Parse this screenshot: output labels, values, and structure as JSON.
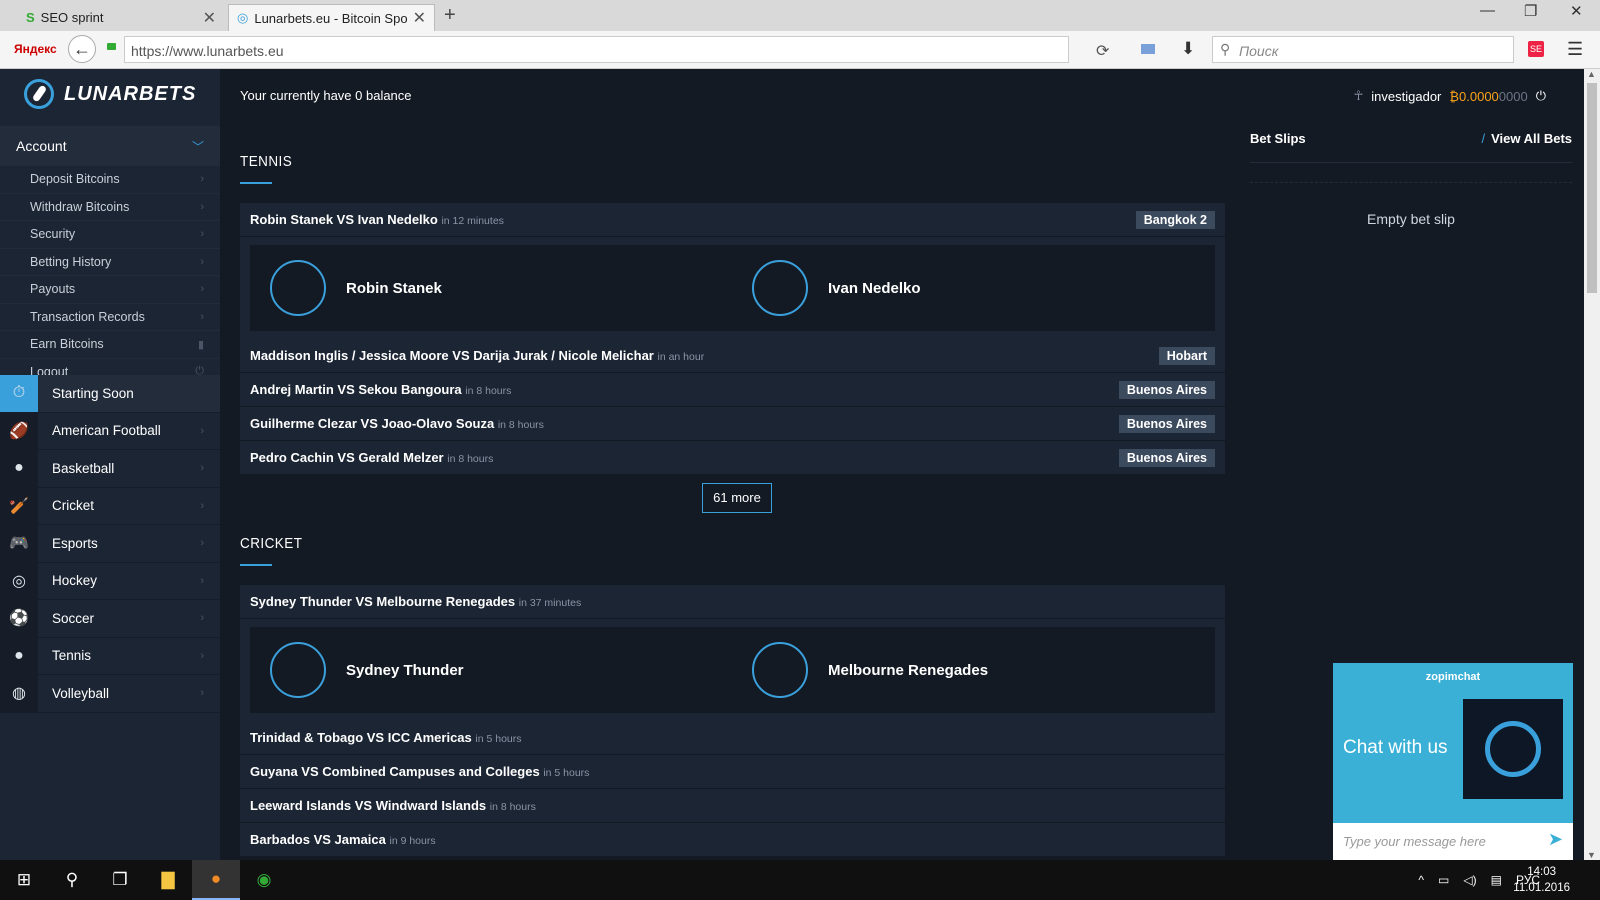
{
  "browser": {
    "tabs": [
      {
        "title": "SEO sprint",
        "icon": "S"
      },
      {
        "title": "Lunarbets.eu - Bitcoin Spo..."
      }
    ],
    "yandex": "Яндекс",
    "url": "https://www.lunarbets.eu",
    "search_placeholder": "Поиск",
    "se_badge": "SE"
  },
  "site": {
    "logo": "LUNARBETS",
    "balance_text": "Your currently have 0 balance",
    "user": {
      "name": "investigador",
      "btc_symbol": "₿",
      "amount": "0.0000",
      "amount_tail": "0000"
    },
    "account_label": "Account",
    "account_items": [
      "Deposit Bitcoins",
      "Withdraw Bitcoins",
      "Security",
      "Betting History",
      "Payouts",
      "Transaction Records",
      "Earn Bitcoins",
      "Logout"
    ],
    "sports": [
      {
        "label": "Starting Soon",
        "icon": "stopwatch-icon",
        "glyph": "⏱"
      },
      {
        "label": "American Football",
        "icon": "american-football-icon",
        "glyph": "🏈"
      },
      {
        "label": "Basketball",
        "icon": "basketball-icon",
        "glyph": "●"
      },
      {
        "label": "Cricket",
        "icon": "cricket-bat-icon",
        "glyph": "🏏"
      },
      {
        "label": "Esports",
        "icon": "gamepad-icon",
        "glyph": "🎮"
      },
      {
        "label": "Hockey",
        "icon": "hockey-icon",
        "glyph": "◎"
      },
      {
        "label": "Soccer",
        "icon": "soccer-ball-icon",
        "glyph": "⚽"
      },
      {
        "label": "Tennis",
        "icon": "tennis-ball-icon",
        "glyph": "●"
      },
      {
        "label": "Volleyball",
        "icon": "volleyball-icon",
        "glyph": "◍"
      }
    ],
    "tennis": {
      "title": "TENNIS",
      "featured": {
        "name": "Robin Stanek VS Ivan Nedelko",
        "when": "in 12 minutes",
        "badge": "Bangkok 2",
        "team1": "Robin Stanek",
        "team2": "Ivan Nedelko"
      },
      "events": [
        {
          "name": "Maddison Inglis / Jessica Moore VS Darija Jurak / Nicole Melichar",
          "when": "in an hour",
          "badge": "Hobart"
        },
        {
          "name": "Andrej Martin VS Sekou Bangoura",
          "when": "in 8 hours",
          "badge": "Buenos Aires"
        },
        {
          "name": "Guilherme Clezar VS Joao-Olavo Souza",
          "when": "in 8 hours",
          "badge": "Buenos Aires"
        },
        {
          "name": "Pedro Cachin VS Gerald Melzer",
          "when": "in 8 hours",
          "badge": "Buenos Aires"
        }
      ],
      "more": "61 more"
    },
    "cricket": {
      "title": "CRICKET",
      "featured": {
        "name": "Sydney Thunder VS Melbourne Renegades",
        "when": "in 37 minutes",
        "team1": "Sydney Thunder",
        "team2": "Melbourne Renegades"
      },
      "events": [
        {
          "name": "Trinidad & Tobago VS ICC Americas",
          "when": "in 5 hours"
        },
        {
          "name": "Guyana VS Combined Campuses and Colleges",
          "when": "in 5 hours"
        },
        {
          "name": "Leeward Islands VS Windward Islands",
          "when": "in 8 hours"
        },
        {
          "name": "Barbados VS Jamaica",
          "when": "in 9 hours"
        }
      ]
    },
    "betslip": {
      "title": "Bet Slips",
      "slash": "/",
      "view_all": "View All Bets",
      "empty": "Empty bet slip"
    }
  },
  "chat": {
    "brand": "zopimchat",
    "title": "Chat with us",
    "placeholder": "Type your message here"
  },
  "taskbar": {
    "lang": "РУС",
    "time": "14:03",
    "date": "11.01.2016"
  },
  "colors": {
    "accent": "#3aa0dc",
    "btc": "#f7a21b"
  }
}
